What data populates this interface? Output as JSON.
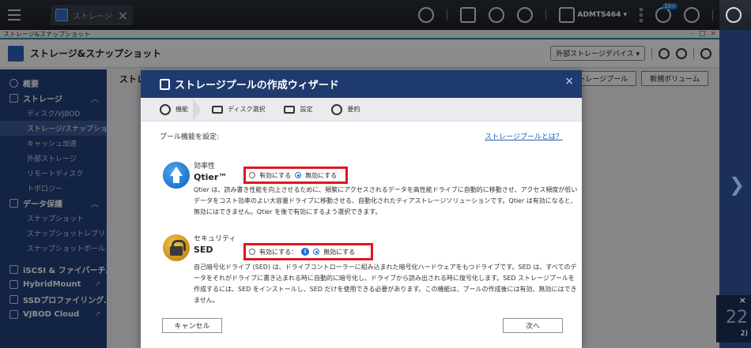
{
  "os_bar": {
    "tab_label": "ストレージ",
    "username": "ADMTS464 ▾",
    "notification_badge": "10+"
  },
  "window": {
    "title": "ストレージ&スナップショット",
    "app_title": "ストレージ&スナップショット",
    "ext_device_btn": "外部ストレージデバイス ▾",
    "main_heading": "ストレージ",
    "main_buttons": [
      "ストレージプール",
      "新規ボリューム"
    ]
  },
  "sidebar": {
    "overview": "概要",
    "storage": "ストレージ",
    "storage_items": [
      "ディスク/VJBOD",
      "ストレージ/スナップショ…",
      "キャッシュ加速",
      "外部ストレージ",
      "リモートディスク",
      "トポロジー"
    ],
    "data_protection": "データ保護",
    "dp_items": [
      "スナップショット",
      "スナップショットレプリカ",
      "スナップショットボールト"
    ],
    "links": [
      "iSCSI & ファイバーチ…",
      "HybridMount",
      "SSDプロファイリング…",
      "VJBOD Cloud"
    ]
  },
  "notification": {
    "big_number": "22",
    "tail_text": "2)"
  },
  "dialog": {
    "title": "ストレージプールの作成ウィザード",
    "close": "×",
    "steps": [
      "機能",
      "ディスク選択",
      "設定",
      "要約"
    ],
    "prompt": "プール機能を設定:",
    "help_link": "ストレージプールとは？",
    "features": [
      {
        "category": "効率性",
        "name": "Qtier™",
        "enable_label": "有効にする",
        "disable_label": "無効にする",
        "selected": "disable",
        "description": "Qtier は、読み書き性能を向上させるために、頻繁にアクセスされるデータを高性能ドライブに自動的に移動させ、アクセス頻度が低いデータをコスト効率のよい大容量ドライブに移動させる、自動化されたティアストレージソリューションです。Qtier は有効になると、無効にはできません。Qtier を後で有効にするよう選択できます。"
      },
      {
        "category": "セキュリティ",
        "name": "SED",
        "enable_label": "有効にする：",
        "disable_label": "無効にする",
        "selected": "disable",
        "description": "自己暗号化ドライブ (SED) は、ドライブコントローラーに組み込まれた暗号化ハードウェアをもつドライブです。SED は、すべてのデータをそれがドライブに書き込まれる時に自動的に暗号化し、ドライブから読み出される時に復号化します。SED ストレージプールを作成するには、SED をインストールし、SED だけを使用できる必要があります。この機能は、プールの作成後には有効、無効にはできません。"
      }
    ],
    "cancel": "キャンセル",
    "next": "次へ"
  },
  "colors": {
    "dialog_header": "#1f3a6e",
    "sidebar": "#24407a",
    "highlight_box": "#e0161e",
    "link": "#1a5fb4"
  }
}
